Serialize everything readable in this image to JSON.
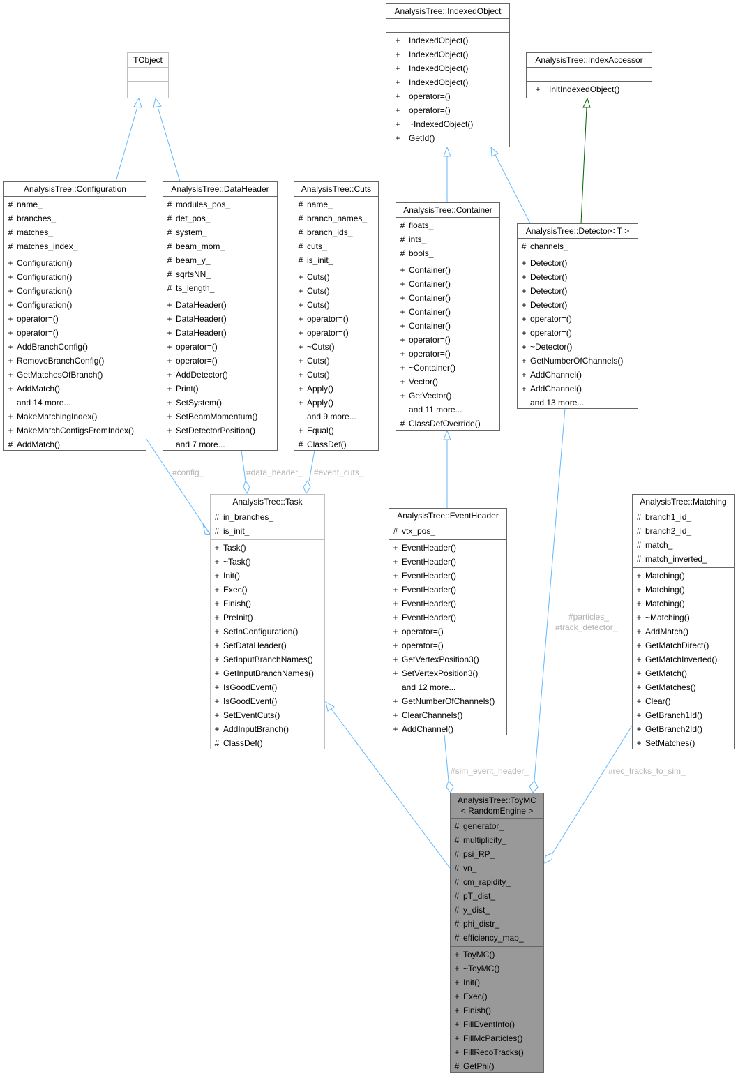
{
  "diagram": {
    "type": "uml-class-collaboration",
    "colors": {
      "inheritance": "#63b8ff",
      "usage": "#63b8ff",
      "protected_inheritance": "#006400",
      "focus_fill": "#999999",
      "box_border": "#666666",
      "label_text": "#b3b3b3"
    }
  },
  "classes": {
    "tobject": {
      "title": "TObject",
      "attrs": [],
      "methods": []
    },
    "indexedobject": {
      "title": "AnalysisTree::IndexedObject",
      "attrs": [],
      "methods": [
        {
          "v": "+",
          "n": "IndexedObject()"
        },
        {
          "v": "+",
          "n": "IndexedObject()"
        },
        {
          "v": "+",
          "n": "IndexedObject()"
        },
        {
          "v": "+",
          "n": "IndexedObject()"
        },
        {
          "v": "+",
          "n": "operator=()"
        },
        {
          "v": "+",
          "n": "operator=()"
        },
        {
          "v": "+",
          "n": "~IndexedObject()"
        },
        {
          "v": "+",
          "n": "GetId()"
        }
      ]
    },
    "indexaccessor": {
      "title": "AnalysisTree::IndexAccessor",
      "attrs": [],
      "methods": [
        {
          "v": "+",
          "n": "InitIndexedObject()"
        }
      ]
    },
    "configuration": {
      "title": "AnalysisTree::Configuration",
      "attrs": [
        {
          "v": "#",
          "n": "name_"
        },
        {
          "v": "#",
          "n": "branches_"
        },
        {
          "v": "#",
          "n": "matches_"
        },
        {
          "v": "#",
          "n": "matches_index_"
        }
      ],
      "methods": [
        {
          "v": "+",
          "n": "Configuration()"
        },
        {
          "v": "+",
          "n": "Configuration()"
        },
        {
          "v": "+",
          "n": "Configuration()"
        },
        {
          "v": "+",
          "n": "Configuration()"
        },
        {
          "v": "+",
          "n": "operator=()"
        },
        {
          "v": "+",
          "n": "operator=()"
        },
        {
          "v": "+",
          "n": "AddBranchConfig()"
        },
        {
          "v": "+",
          "n": "RemoveBranchConfig()"
        },
        {
          "v": "+",
          "n": "GetMatchesOfBranch()"
        },
        {
          "v": "+",
          "n": "AddMatch()"
        },
        {
          "v": "",
          "n": "and 14 more..."
        },
        {
          "v": "+",
          "n": "MakeMatchingIndex()"
        },
        {
          "v": "+",
          "n": "MakeMatchConfigsFromIndex()"
        },
        {
          "v": "#",
          "n": "AddMatch()"
        }
      ]
    },
    "dataheader": {
      "title": "AnalysisTree::DataHeader",
      "attrs": [
        {
          "v": "#",
          "n": "modules_pos_"
        },
        {
          "v": "#",
          "n": "det_pos_"
        },
        {
          "v": "#",
          "n": "system_"
        },
        {
          "v": "#",
          "n": "beam_mom_"
        },
        {
          "v": "#",
          "n": "beam_y_"
        },
        {
          "v": "#",
          "n": "sqrtsNN_"
        },
        {
          "v": "#",
          "n": "ts_length_"
        }
      ],
      "methods": [
        {
          "v": "+",
          "n": "DataHeader()"
        },
        {
          "v": "+",
          "n": "DataHeader()"
        },
        {
          "v": "+",
          "n": "DataHeader()"
        },
        {
          "v": "+",
          "n": "operator=()"
        },
        {
          "v": "+",
          "n": "operator=()"
        },
        {
          "v": "+",
          "n": "AddDetector()"
        },
        {
          "v": "+",
          "n": "Print()"
        },
        {
          "v": "+",
          "n": "SetSystem()"
        },
        {
          "v": "+",
          "n": "SetBeamMomentum()"
        },
        {
          "v": "+",
          "n": "SetDetectorPosition()"
        },
        {
          "v": "",
          "n": "and 7 more..."
        }
      ]
    },
    "cuts": {
      "title": "AnalysisTree::Cuts",
      "attrs": [
        {
          "v": "#",
          "n": "name_"
        },
        {
          "v": "#",
          "n": "branch_names_"
        },
        {
          "v": "#",
          "n": "branch_ids_"
        },
        {
          "v": "#",
          "n": "cuts_"
        },
        {
          "v": "#",
          "n": "is_init_"
        }
      ],
      "methods": [
        {
          "v": "+",
          "n": "Cuts()"
        },
        {
          "v": "+",
          "n": "Cuts()"
        },
        {
          "v": "+",
          "n": "Cuts()"
        },
        {
          "v": "+",
          "n": "operator=()"
        },
        {
          "v": "+",
          "n": "operator=()"
        },
        {
          "v": "+",
          "n": "~Cuts()"
        },
        {
          "v": "+",
          "n": "Cuts()"
        },
        {
          "v": "+",
          "n": "Cuts()"
        },
        {
          "v": "+",
          "n": "Apply()"
        },
        {
          "v": "+",
          "n": "Apply()"
        },
        {
          "v": "",
          "n": "and 9 more..."
        },
        {
          "v": "+",
          "n": "Equal()"
        },
        {
          "v": "#",
          "n": "ClassDef()"
        }
      ]
    },
    "container": {
      "title": "AnalysisTree::Container",
      "attrs": [
        {
          "v": "#",
          "n": "floats_"
        },
        {
          "v": "#",
          "n": "ints_"
        },
        {
          "v": "#",
          "n": "bools_"
        }
      ],
      "methods": [
        {
          "v": "+",
          "n": "Container()"
        },
        {
          "v": "+",
          "n": "Container()"
        },
        {
          "v": "+",
          "n": "Container()"
        },
        {
          "v": "+",
          "n": "Container()"
        },
        {
          "v": "+",
          "n": "Container()"
        },
        {
          "v": "+",
          "n": "operator=()"
        },
        {
          "v": "+",
          "n": "operator=()"
        },
        {
          "v": "+",
          "n": "~Container()"
        },
        {
          "v": "+",
          "n": "Vector()"
        },
        {
          "v": "+",
          "n": "GetVector()"
        },
        {
          "v": "",
          "n": "and 11 more..."
        },
        {
          "v": "#",
          "n": "ClassDefOverride()"
        }
      ]
    },
    "detector": {
      "title": "AnalysisTree::Detector< T >",
      "attrs": [
        {
          "v": "#",
          "n": "channels_"
        }
      ],
      "methods": [
        {
          "v": "+",
          "n": "Detector()"
        },
        {
          "v": "+",
          "n": "Detector()"
        },
        {
          "v": "+",
          "n": "Detector()"
        },
        {
          "v": "+",
          "n": "Detector()"
        },
        {
          "v": "+",
          "n": "operator=()"
        },
        {
          "v": "+",
          "n": "operator=()"
        },
        {
          "v": "+",
          "n": "~Detector()"
        },
        {
          "v": "+",
          "n": "GetNumberOfChannels()"
        },
        {
          "v": "+",
          "n": "AddChannel()"
        },
        {
          "v": "+",
          "n": "AddChannel()"
        },
        {
          "v": "",
          "n": "and 13 more..."
        }
      ]
    },
    "task": {
      "title": "AnalysisTree::Task",
      "attrs": [
        {
          "v": "#",
          "n": "in_branches_"
        },
        {
          "v": "#",
          "n": "is_init_"
        }
      ],
      "methods": [
        {
          "v": "+",
          "n": "Task()"
        },
        {
          "v": "+",
          "n": "~Task()"
        },
        {
          "v": "+",
          "n": "Init()"
        },
        {
          "v": "+",
          "n": "Exec()"
        },
        {
          "v": "+",
          "n": "Finish()"
        },
        {
          "v": "+",
          "n": "PreInit()"
        },
        {
          "v": "+",
          "n": "SetInConfiguration()"
        },
        {
          "v": "+",
          "n": "SetDataHeader()"
        },
        {
          "v": "+",
          "n": "SetInputBranchNames()"
        },
        {
          "v": "+",
          "n": "GetInputBranchNames()"
        },
        {
          "v": "+",
          "n": "IsGoodEvent()"
        },
        {
          "v": "+",
          "n": "IsGoodEvent()"
        },
        {
          "v": "+",
          "n": "SetEventCuts()"
        },
        {
          "v": "+",
          "n": "AddInputBranch()"
        },
        {
          "v": "#",
          "n": "ClassDef()"
        }
      ]
    },
    "eventheader": {
      "title": "AnalysisTree::EventHeader",
      "attrs": [
        {
          "v": "#",
          "n": "vtx_pos_"
        }
      ],
      "methods": [
        {
          "v": "+",
          "n": "EventHeader()"
        },
        {
          "v": "+",
          "n": "EventHeader()"
        },
        {
          "v": "+",
          "n": "EventHeader()"
        },
        {
          "v": "+",
          "n": "EventHeader()"
        },
        {
          "v": "+",
          "n": "EventHeader()"
        },
        {
          "v": "+",
          "n": "EventHeader()"
        },
        {
          "v": "+",
          "n": "operator=()"
        },
        {
          "v": "+",
          "n": "operator=()"
        },
        {
          "v": "+",
          "n": "GetVertexPosition3()"
        },
        {
          "v": "+",
          "n": "SetVertexPosition3()"
        },
        {
          "v": "",
          "n": "and 12 more..."
        },
        {
          "v": "+",
          "n": "GetNumberOfChannels()"
        },
        {
          "v": "+",
          "n": "ClearChannels()"
        },
        {
          "v": "+",
          "n": "AddChannel()"
        }
      ]
    },
    "matching": {
      "title": "AnalysisTree::Matching",
      "attrs": [
        {
          "v": "#",
          "n": "branch1_id_"
        },
        {
          "v": "#",
          "n": "branch2_id_"
        },
        {
          "v": "#",
          "n": "match_"
        },
        {
          "v": "#",
          "n": "match_inverted_"
        }
      ],
      "methods": [
        {
          "v": "+",
          "n": "Matching()"
        },
        {
          "v": "+",
          "n": "Matching()"
        },
        {
          "v": "+",
          "n": "Matching()"
        },
        {
          "v": "+",
          "n": "~Matching()"
        },
        {
          "v": "+",
          "n": "AddMatch()"
        },
        {
          "v": "+",
          "n": "GetMatchDirect()"
        },
        {
          "v": "+",
          "n": "GetMatchInverted()"
        },
        {
          "v": "+",
          "n": "GetMatch()"
        },
        {
          "v": "+",
          "n": "GetMatches()"
        },
        {
          "v": "+",
          "n": "Clear()"
        },
        {
          "v": "+",
          "n": "GetBranch1Id()"
        },
        {
          "v": "+",
          "n": "GetBranch2Id()"
        },
        {
          "v": "+",
          "n": "SetMatches()"
        }
      ]
    },
    "toymc": {
      "title": "AnalysisTree::ToyMC",
      "title2": "< RandomEngine >",
      "attrs": [
        {
          "v": "#",
          "n": "generator_"
        },
        {
          "v": "#",
          "n": "multiplicity_"
        },
        {
          "v": "#",
          "n": "psi_RP_"
        },
        {
          "v": "#",
          "n": "vn_"
        },
        {
          "v": "#",
          "n": "cm_rapidity_"
        },
        {
          "v": "#",
          "n": "pT_dist_"
        },
        {
          "v": "#",
          "n": "y_dist_"
        },
        {
          "v": "#",
          "n": "phi_distr_"
        },
        {
          "v": "#",
          "n": "efficiency_map_"
        }
      ],
      "methods": [
        {
          "v": "+",
          "n": "ToyMC()"
        },
        {
          "v": "+",
          "n": "~ToyMC()"
        },
        {
          "v": "+",
          "n": "Init()"
        },
        {
          "v": "+",
          "n": "Exec()"
        },
        {
          "v": "+",
          "n": "Finish()"
        },
        {
          "v": "+",
          "n": "FillEventInfo()"
        },
        {
          "v": "+",
          "n": "FillMcParticles()"
        },
        {
          "v": "+",
          "n": "FillRecoTracks()"
        },
        {
          "v": "#",
          "n": "GetPhi()"
        }
      ]
    }
  },
  "edge_labels": {
    "config": "#config_",
    "data_header": "#data_header_",
    "event_cuts": "#event_cuts_",
    "particles": "#particles_",
    "track_detector": "#track_detector_",
    "sim_event_header": "#sim_event_header_",
    "rec_tracks_to_sim": "#rec_tracks_to_sim_"
  },
  "relations": [
    {
      "from": "configuration",
      "to": "tobject",
      "kind": "inheritance"
    },
    {
      "from": "dataheader",
      "to": "tobject",
      "kind": "inheritance"
    },
    {
      "from": "container",
      "to": "indexedobject",
      "kind": "inheritance"
    },
    {
      "from": "detector",
      "to": "indexedobject",
      "kind": "inheritance"
    },
    {
      "from": "detector",
      "to": "indexaccessor",
      "kind": "protected-inheritance"
    },
    {
      "from": "eventheader",
      "to": "container",
      "kind": "inheritance"
    },
    {
      "from": "toymc",
      "to": "task",
      "kind": "inheritance"
    },
    {
      "from": "configuration",
      "to": "task",
      "kind": "usage",
      "label": "#config_"
    },
    {
      "from": "dataheader",
      "to": "task",
      "kind": "usage",
      "label": "#data_header_"
    },
    {
      "from": "cuts",
      "to": "task",
      "kind": "usage",
      "label": "#event_cuts_"
    },
    {
      "from": "eventheader",
      "to": "toymc",
      "kind": "usage",
      "label": "#sim_event_header_"
    },
    {
      "from": "detector",
      "to": "toymc",
      "kind": "usage",
      "label": "#particles_ #track_detector_"
    },
    {
      "from": "matching",
      "to": "toymc",
      "kind": "usage",
      "label": "#rec_tracks_to_sim_"
    }
  ]
}
